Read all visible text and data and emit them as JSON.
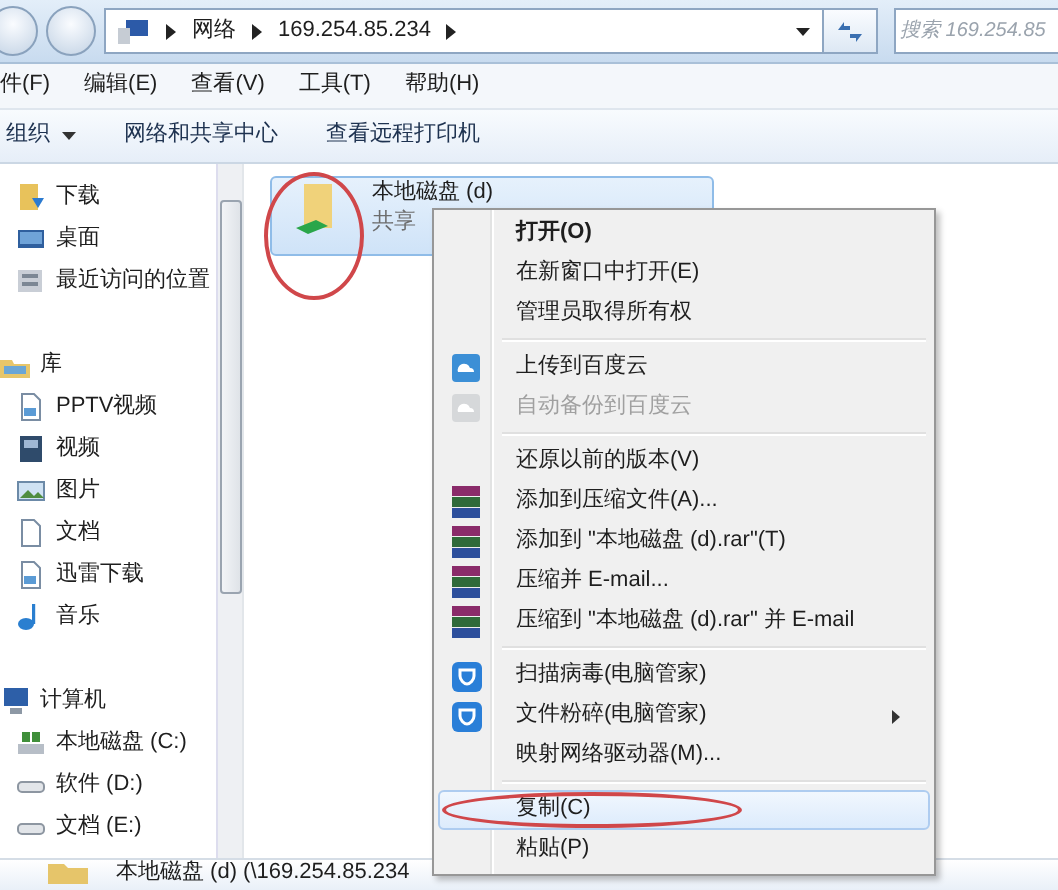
{
  "address_bar": {
    "crumbs": [
      "网络",
      "169.254.85.234"
    ]
  },
  "search": {
    "placeholder": "搜索 169.254.85"
  },
  "menu_bar": [
    "件(F)",
    "编辑(E)",
    "查看(V)",
    "工具(T)",
    "帮助(H)"
  ],
  "toolbar": [
    {
      "label": "组织",
      "dropdown": true
    },
    {
      "label": "网络和共享中心",
      "dropdown": false
    },
    {
      "label": "查看远程打印机",
      "dropdown": false
    }
  ],
  "sidebar": {
    "sections": [
      {
        "items": [
          {
            "label": "下载",
            "kind": "download"
          },
          {
            "label": "桌面",
            "kind": "desktop"
          },
          {
            "label": "最近访问的位置",
            "kind": "recent"
          }
        ]
      },
      {
        "title": "库",
        "kind": "library",
        "children": [
          {
            "label": "PPTV视频",
            "kind": "file"
          },
          {
            "label": "视频",
            "kind": "video"
          },
          {
            "label": "图片",
            "kind": "pictures"
          },
          {
            "label": "文档",
            "kind": "document"
          },
          {
            "label": "迅雷下载",
            "kind": "file"
          },
          {
            "label": "音乐",
            "kind": "music"
          }
        ]
      },
      {
        "title": "计算机",
        "kind": "computer",
        "children": [
          {
            "label": "本地磁盘 (C:)",
            "kind": "system-drive"
          },
          {
            "label": "软件 (D:)",
            "kind": "drive"
          },
          {
            "label": "文档 (E:)",
            "kind": "drive"
          }
        ]
      }
    ]
  },
  "files": [
    {
      "name": "本地磁盘 (d)",
      "subtitle": "共享",
      "selected": true,
      "circled": true
    }
  ],
  "context_menu": [
    {
      "kind": "plain",
      "label": "打开(O)",
      "default": true,
      "disabled": false,
      "highlighted": false,
      "submenu": false,
      "circled": false
    },
    {
      "kind": "plain",
      "label": "在新窗口中打开(E)",
      "default": false,
      "disabled": false,
      "highlighted": false,
      "submenu": false,
      "circled": false
    },
    {
      "kind": "plain",
      "label": "管理员取得所有权",
      "default": false,
      "disabled": false,
      "highlighted": false,
      "submenu": false,
      "circled": false
    },
    {
      "kind": "separator"
    },
    {
      "kind": "cloud",
      "label": "上传到百度云",
      "default": false,
      "disabled": false,
      "highlighted": false,
      "submenu": false,
      "circled": false
    },
    {
      "kind": "cloud",
      "label": "自动备份到百度云",
      "default": false,
      "disabled": true,
      "highlighted": false,
      "submenu": false,
      "circled": false
    },
    {
      "kind": "separator"
    },
    {
      "kind": "plain",
      "label": "还原以前的版本(V)",
      "default": false,
      "disabled": false,
      "highlighted": false,
      "submenu": false,
      "circled": false
    },
    {
      "kind": "archive",
      "label": "添加到压缩文件(A)...",
      "default": false,
      "disabled": false,
      "highlighted": false,
      "submenu": false,
      "circled": false
    },
    {
      "kind": "archive",
      "label": "添加到 \"本地磁盘 (d).rar\"(T)",
      "default": false,
      "disabled": false,
      "highlighted": false,
      "submenu": false,
      "circled": false
    },
    {
      "kind": "archive",
      "label": "压缩并 E-mail...",
      "default": false,
      "disabled": false,
      "highlighted": false,
      "submenu": false,
      "circled": false
    },
    {
      "kind": "archive",
      "label": "压缩到 \"本地磁盘 (d).rar\" 并 E-mail",
      "default": false,
      "disabled": false,
      "highlighted": false,
      "submenu": false,
      "circled": false
    },
    {
      "kind": "separator"
    },
    {
      "kind": "shield",
      "label": "扫描病毒(电脑管家)",
      "default": false,
      "disabled": false,
      "highlighted": false,
      "submenu": false,
      "circled": false
    },
    {
      "kind": "shield",
      "label": "文件粉碎(电脑管家)",
      "default": false,
      "disabled": false,
      "highlighted": false,
      "submenu": true,
      "circled": false
    },
    {
      "kind": "plain",
      "label": "映射网络驱动器(M)...",
      "default": false,
      "disabled": false,
      "highlighted": false,
      "submenu": false,
      "circled": false
    },
    {
      "kind": "separator"
    },
    {
      "kind": "plain",
      "label": "复制(C)",
      "default": false,
      "disabled": false,
      "highlighted": true,
      "submenu": false,
      "circled": true
    },
    {
      "kind": "plain",
      "label": "粘贴(P)",
      "default": false,
      "disabled": false,
      "highlighted": false,
      "submenu": false,
      "circled": false
    }
  ],
  "details_bar": {
    "text": "本地磁盘 (d) (\\169.254.85.234"
  }
}
